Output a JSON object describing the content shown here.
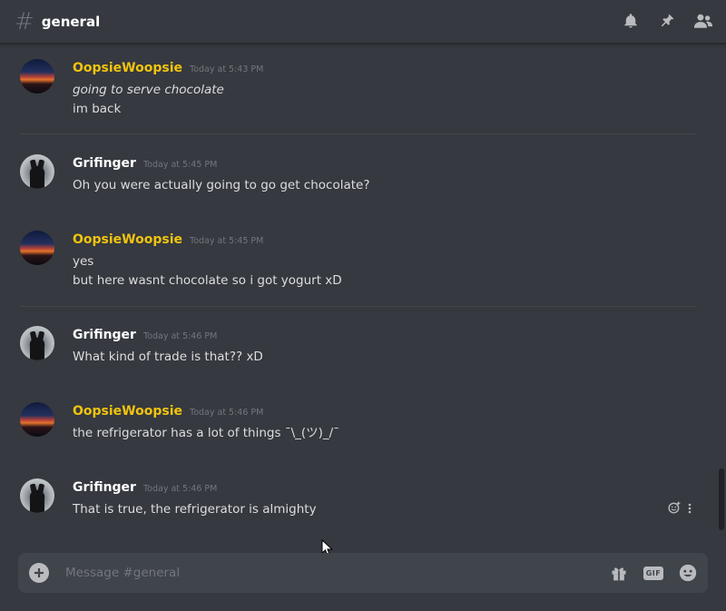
{
  "header": {
    "channel_hash": "#",
    "channel_name": "general",
    "icons": [
      "bell-icon",
      "pin-icon",
      "members-icon"
    ]
  },
  "messages": [
    {
      "author": "OopsieWoopsie",
      "author_color": "#f1c40f",
      "timestamp": "Today at 5:43 PM",
      "avatar": "sunset-avatar",
      "lines": [
        {
          "text": "going to serve chocolate",
          "italic": true
        },
        {
          "text": "im back",
          "italic": false
        }
      ]
    },
    {
      "author": "Grifinger",
      "author_color": "#ffffff",
      "timestamp": "Today at 5:45 PM",
      "avatar": "dog-avatar",
      "lines": [
        {
          "text": "Oh you were actually going to go get chocolate?",
          "italic": false
        }
      ]
    },
    {
      "author": "OopsieWoopsie",
      "author_color": "#f1c40f",
      "timestamp": "Today at 5:45 PM",
      "avatar": "sunset-avatar",
      "lines": [
        {
          "text": "yes",
          "italic": false
        },
        {
          "text": "but here wasnt chocolate so i got yogurt xD",
          "italic": false
        }
      ]
    },
    {
      "author": "Grifinger",
      "author_color": "#ffffff",
      "timestamp": "Today at 5:46 PM",
      "avatar": "dog-avatar",
      "lines": [
        {
          "text": "What kind of trade is that?? xD",
          "italic": false
        }
      ]
    },
    {
      "author": "OopsieWoopsie",
      "author_color": "#f1c40f",
      "timestamp": "Today at 5:46 PM",
      "avatar": "sunset-avatar",
      "lines": [
        {
          "text": "the refrigerator has a lot of things ¯\\_(ツ)_/¯",
          "italic": false
        }
      ]
    },
    {
      "author": "Grifinger",
      "author_color": "#ffffff",
      "timestamp": "Today at 5:46 PM",
      "avatar": "dog-avatar",
      "lines": [
        {
          "text": "That is true, the refrigerator is almighty",
          "italic": false
        }
      ]
    }
  ],
  "composer": {
    "placeholder": "Message #general",
    "value": "",
    "gif_label": "GIF",
    "icons": [
      "add-attachment-icon",
      "gift-icon",
      "gif-icon",
      "emoji-icon"
    ]
  },
  "hover_actions": {
    "icons": [
      "add-reaction-icon",
      "more-options-icon"
    ]
  },
  "colors": {
    "background": "#36393f",
    "composer_background": "#40444b",
    "text": "#dcddde",
    "muted": "#72767d"
  }
}
